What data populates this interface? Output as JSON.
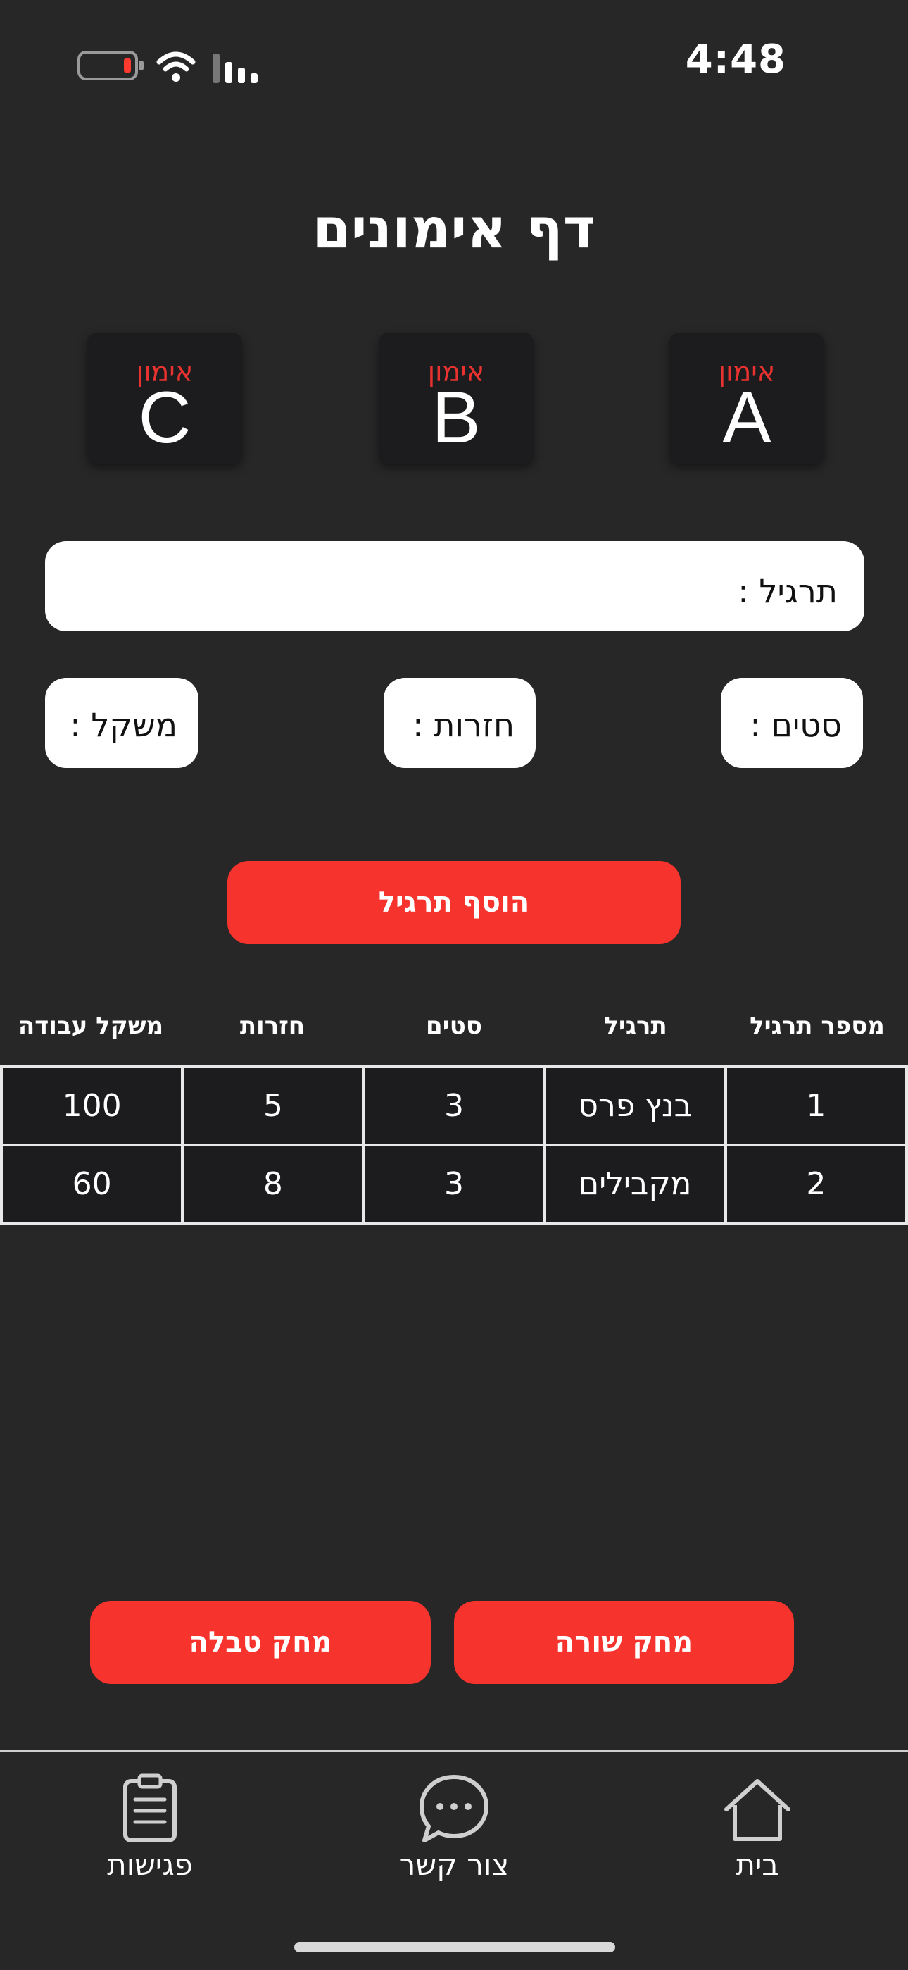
{
  "status_bar": {
    "time": "4:48"
  },
  "page_title": "דף אימונים",
  "workout_cards": [
    {
      "caption": "אימון",
      "letter": "A"
    },
    {
      "caption": "אימון",
      "letter": "B"
    },
    {
      "caption": "אימון",
      "letter": "C"
    }
  ],
  "form": {
    "exercise_label": "תרגיל :",
    "sets_label": "סטים :",
    "reps_label": "חזרות :",
    "weight_label": "משקל :",
    "add_button": "הוסף תרגיל"
  },
  "table": {
    "headers": [
      "מספר תרגיל",
      "תרגיל",
      "סטים",
      "חזרות",
      "משקל עבודה"
    ],
    "rows": [
      [
        "1",
        "בנץ פרס",
        "3",
        "5",
        "100"
      ],
      [
        "2",
        "מקבילים",
        "3",
        "8",
        "60"
      ]
    ]
  },
  "actions": {
    "delete_row": "מחק שורה",
    "delete_table": "מחק טבלה"
  },
  "colors": {
    "accent": "#f7332e",
    "background": "#272727",
    "card": "#1c1c1e"
  },
  "tab_bar": [
    {
      "label": "בית",
      "icon": "home-icon"
    },
    {
      "label": "צור קשר",
      "icon": "chat-bubble-icon"
    },
    {
      "label": "פגישות",
      "icon": "clipboard-icon"
    }
  ]
}
